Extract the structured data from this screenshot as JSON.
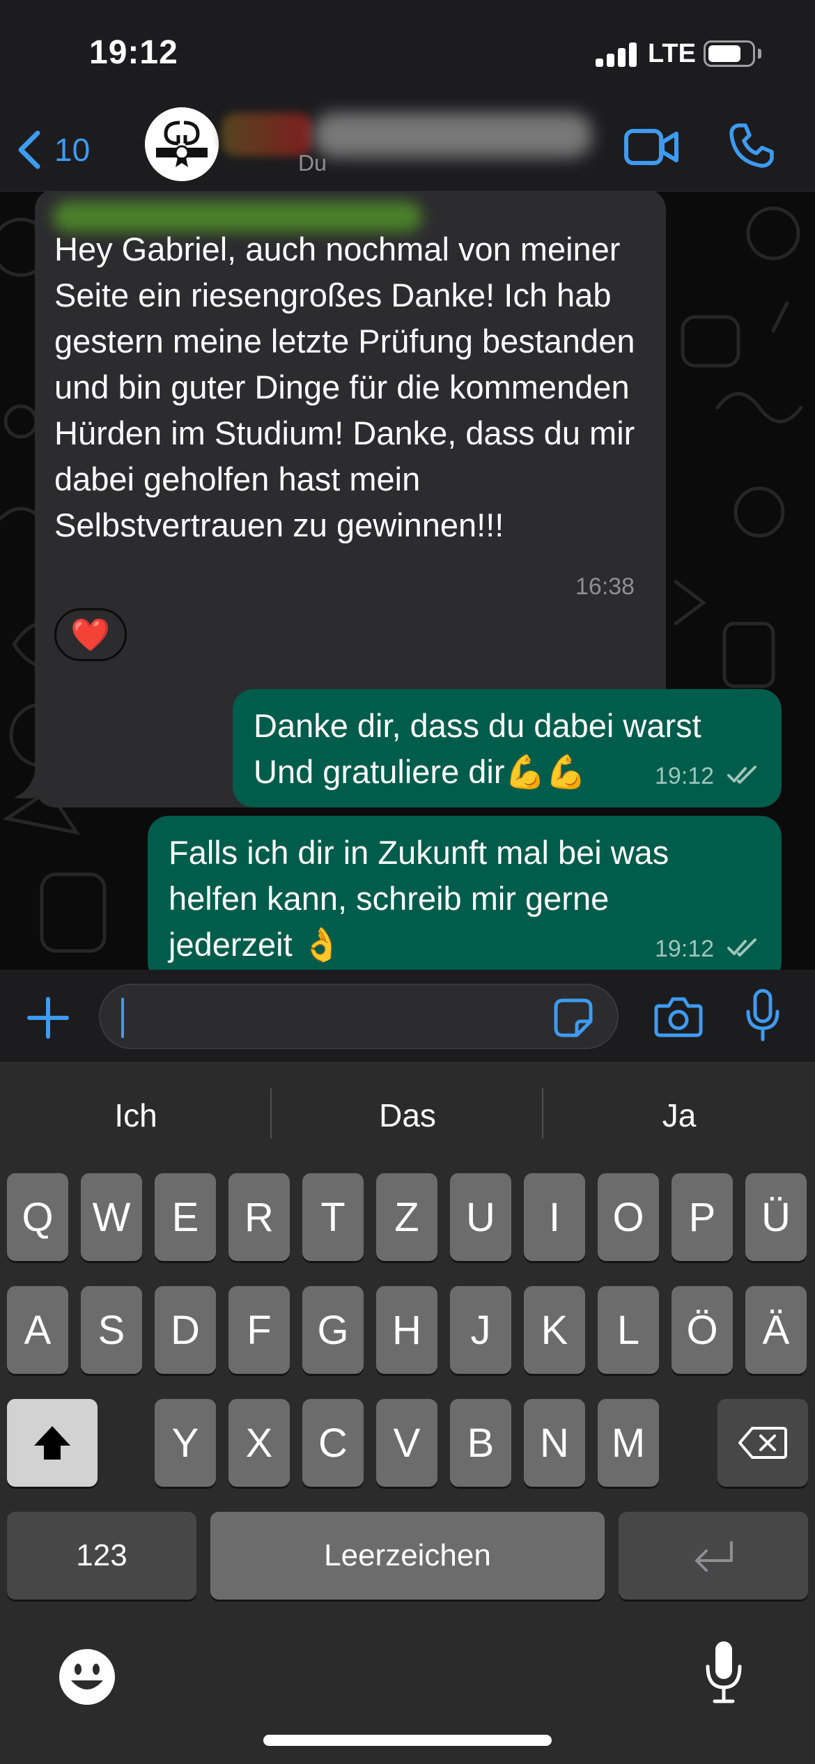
{
  "status_bar": {
    "time": "19:12",
    "network": "LTE"
  },
  "header": {
    "back_count": "10",
    "subtitle": "Du"
  },
  "messages": {
    "incoming": {
      "text": "Hey Gabriel, auch nochmal von meiner Seite ein riesengroßes Danke! Ich hab gestern meine letzte Prüfung bestanden und bin guter Dinge für die kommenden Hürden im Studium! Danke, dass du mir dabei geholfen hast mein Selbstvertrauen zu gewinnen!!!",
      "time": "16:38",
      "reaction": "❤️"
    },
    "outgoing": [
      {
        "line1": "Danke dir, dass du dabei warst",
        "line2": "Und gratuliere dir💪💪",
        "time": "19:12"
      },
      {
        "line1": "Falls ich dir in Zukunft mal bei was",
        "line2": "helfen kann, schreib mir gerne",
        "line3": "jederzeit 👌",
        "time": "19:12"
      }
    ]
  },
  "input": {
    "placeholder": ""
  },
  "keyboard": {
    "suggestions": [
      "Ich",
      "Das",
      "Ja"
    ],
    "row1": [
      "Q",
      "W",
      "E",
      "R",
      "T",
      "Z",
      "U",
      "I",
      "O",
      "P",
      "Ü"
    ],
    "row2": [
      "A",
      "S",
      "D",
      "F",
      "G",
      "H",
      "J",
      "K",
      "L",
      "Ö",
      "Ä"
    ],
    "row3": [
      "Y",
      "X",
      "C",
      "V",
      "B",
      "N",
      "M"
    ],
    "numbers_label": "123",
    "space_label": "Leerzeichen"
  },
  "colors": {
    "accent": "#3e9bf2",
    "incoming_bubble": "#2c2c2e",
    "outgoing_bubble": "#005c4b"
  },
  "icons": [
    "chevron-left-icon",
    "video-call-icon",
    "phone-icon",
    "plus-icon",
    "sticker-icon",
    "camera-icon",
    "microphone-icon",
    "shift-icon",
    "backspace-icon",
    "return-icon",
    "emoji-icon",
    "dictation-icon",
    "double-check-icon"
  ]
}
